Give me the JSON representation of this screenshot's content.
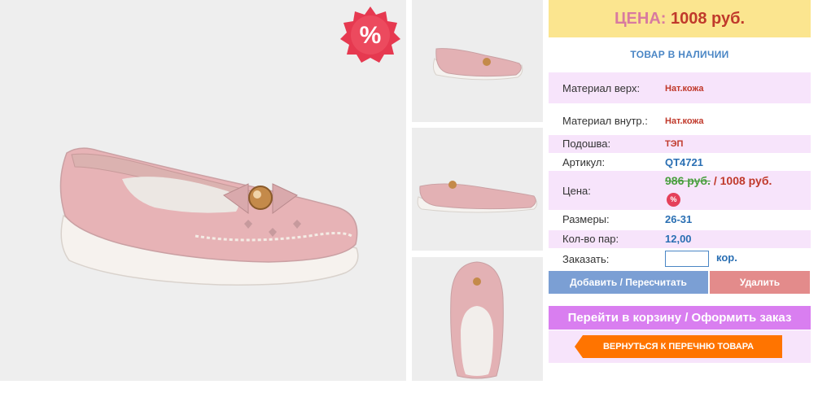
{
  "product": {
    "main_image": "pink leather girls' loafer with bow and gold button",
    "thumbnails": [
      {
        "alt": "pink loafer side view"
      },
      {
        "alt": "pink loafer side view"
      },
      {
        "alt": "pink loafer top view"
      }
    ],
    "discount_badge": "%"
  },
  "price_header": {
    "label": "ЦЕНА:",
    "value": "1008 руб."
  },
  "stock_status": "ТОВАР В НАЛИЧИИ",
  "specs": [
    {
      "label": "Материал верх:",
      "value": "Нат.кожа"
    },
    {
      "label": "Материал внутр.:",
      "value": "Нат.кожа"
    },
    {
      "label": "Подошва:",
      "value": "ТЭП"
    },
    {
      "label": "Артикул:",
      "value": "QT4721"
    }
  ],
  "price_row": {
    "label": "Цена:",
    "old": "986 руб.",
    "separator": " / ",
    "new": "1008 руб.",
    "badge": "%"
  },
  "sizes": {
    "label": "Размеры:",
    "value": "26-31"
  },
  "pairs": {
    "label": "Кол-во пар:",
    "value": "12,00"
  },
  "order": {
    "label": "Заказать:",
    "value": "",
    "unit": "кор."
  },
  "buttons": {
    "add": "Добавить / Пересчитать",
    "delete": "Удалить",
    "cart": "Перейти в корзину / Оформить заказ",
    "back": "ВЕРНУТЬСЯ К ПЕРЕЧНЮ ТОВАРА"
  },
  "colors": {
    "price_header_bg": "#fbe58f",
    "pink_row": "#f7e4fb",
    "back_button": "#ff7400",
    "cart_button": "#d97ef0"
  }
}
